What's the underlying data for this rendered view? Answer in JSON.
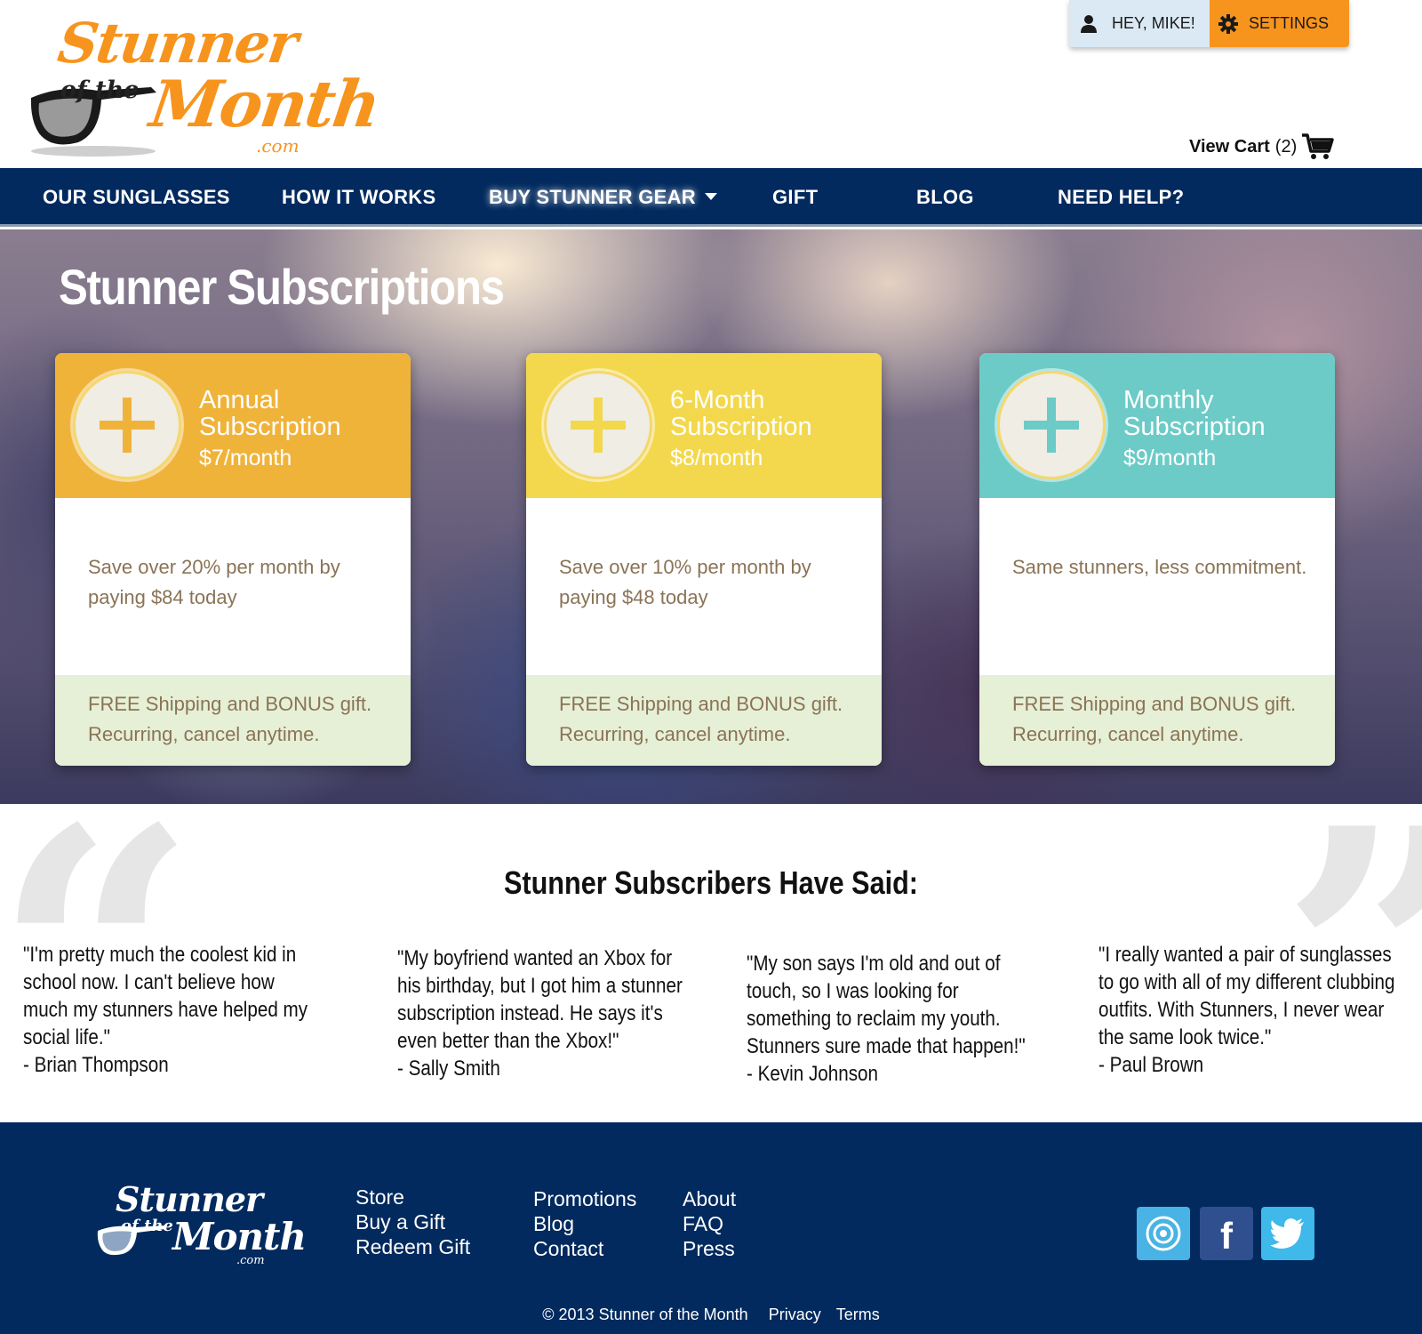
{
  "brand": {
    "logo_line1": "Stunner",
    "logo_line2": "of the",
    "logo_line3": "Month",
    "logo_suffix": ".com",
    "primary_color": "#f7941d",
    "navy_color": "#022a5e"
  },
  "header": {
    "greeting": "HEY, MIKE!",
    "settings_label": "SETTINGS",
    "cart_label": "View Cart",
    "cart_count": "(2)"
  },
  "nav": {
    "items": [
      {
        "label": "OUR SUNGLASSES"
      },
      {
        "label": "HOW IT WORKS"
      },
      {
        "label": "BUY STUNNER GEAR"
      },
      {
        "label": "GIFT"
      },
      {
        "label": "BLOG"
      },
      {
        "label": "NEED HELP?"
      }
    ]
  },
  "hero": {
    "title": "Stunner Subscriptions",
    "plans": [
      {
        "name_line1": "Annual",
        "name_line2": "Subscription",
        "price": "$7/month",
        "description": "Save over 20% per month by paying $84 today",
        "footer": "FREE Shipping and BONUS gift. Recurring, cancel anytime.",
        "color": "#f0b33a"
      },
      {
        "name_line1": "6-Month",
        "name_line2": "Subscription",
        "price": "$8/month",
        "description": "Save over 10% per month by paying $48 today",
        "footer": "FREE Shipping and BONUS gift. Recurring, cancel anytime.",
        "color": "#f3d84e"
      },
      {
        "name_line1": "Monthly",
        "name_line2": "Subscription",
        "price": "$9/month",
        "description": "Same stunners, less commitment.",
        "footer": "FREE Shipping and BONUS gift. Recurring, cancel anytime.",
        "color": "#6ccbc7"
      }
    ]
  },
  "testimonials": {
    "title": "Stunner Subscribers Have Said:",
    "items": [
      {
        "quote": "\"I'm pretty much the coolest kid in school now. I can't believe how much my stunners have helped my social life.\"",
        "author": "- Brian Thompson"
      },
      {
        "quote": "\"My boyfriend wanted an Xbox for his birthday, but I got him a stunner subscription instead. He says it's even better than the Xbox!\"",
        "author": "- Sally Smith"
      },
      {
        "quote": "\"My son says I'm old and out of touch, so I was looking for something to reclaim my youth. Stunners sure made that happen!\"",
        "author": "- Kevin Johnson"
      },
      {
        "quote": "\"I really wanted a pair of sunglasses to go with all of my different clubbing outfits. With Stunners, I never wear the same look twice.\"",
        "author": "- Paul Brown"
      }
    ]
  },
  "footer": {
    "col1": [
      "Store",
      "Buy a Gift",
      "Redeem Gift"
    ],
    "col2": [
      "Promotions",
      "Blog",
      "Contact"
    ],
    "col3": [
      "About",
      "FAQ",
      "Press"
    ],
    "social": [
      {
        "icon": "dribbble-icon",
        "color": "#48b3e4"
      },
      {
        "icon": "facebook-icon",
        "color": "#2f4f8f"
      },
      {
        "icon": "twitter-icon",
        "color": "#3fb8ea"
      }
    ],
    "copyright": "© 2013 Stunner of the Month",
    "privacy": "Privacy",
    "terms": "Terms"
  }
}
